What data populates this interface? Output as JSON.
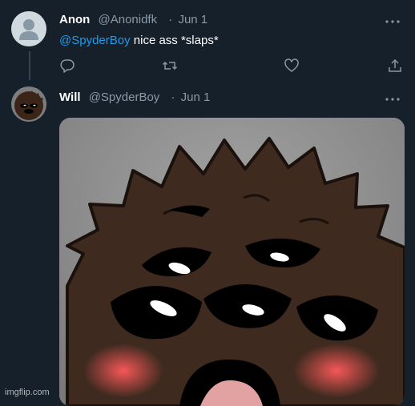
{
  "tweets": [
    {
      "name": "Anon",
      "handle": "@Anonidfk",
      "separator": "·",
      "date": "Jun 1",
      "mention": "@SpyderBoy",
      "text": " nice ass *slaps*",
      "avatar": "default-profile-icon"
    },
    {
      "name": "Will",
      "handle": "@SpyderBoy",
      "separator": "·",
      "date": "Jun 1",
      "avatar": "cartoon-face-avatar",
      "media": "cartoon-face-image"
    }
  ],
  "watermark": "imgflip.com",
  "colors": {
    "background": "#15202b",
    "accent": "#1d9bf0",
    "muted": "#8b98a5",
    "thread_line": "#38444d"
  }
}
